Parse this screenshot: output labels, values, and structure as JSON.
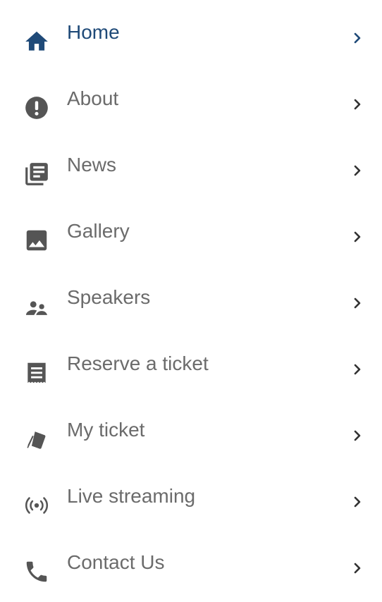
{
  "menu": {
    "active_color": "#1f4a78",
    "text_color": "#6b6b6b",
    "icon_color": "#555555",
    "chevron_color": "#333333",
    "items": [
      {
        "label": "Home",
        "icon": "home-icon",
        "active": true
      },
      {
        "label": "About",
        "icon": "info-alert-icon",
        "active": false
      },
      {
        "label": "News",
        "icon": "newspaper-icon",
        "active": false
      },
      {
        "label": "Gallery",
        "icon": "image-icon",
        "active": false
      },
      {
        "label": "Speakers",
        "icon": "people-icon",
        "active": false
      },
      {
        "label": "Reserve a ticket",
        "icon": "receipt-icon",
        "active": false
      },
      {
        "label": "My ticket",
        "icon": "ticket-icon",
        "active": false
      },
      {
        "label": "Live streaming",
        "icon": "broadcast-icon",
        "active": false
      },
      {
        "label": "Contact Us",
        "icon": "phone-icon",
        "active": false
      }
    ]
  }
}
